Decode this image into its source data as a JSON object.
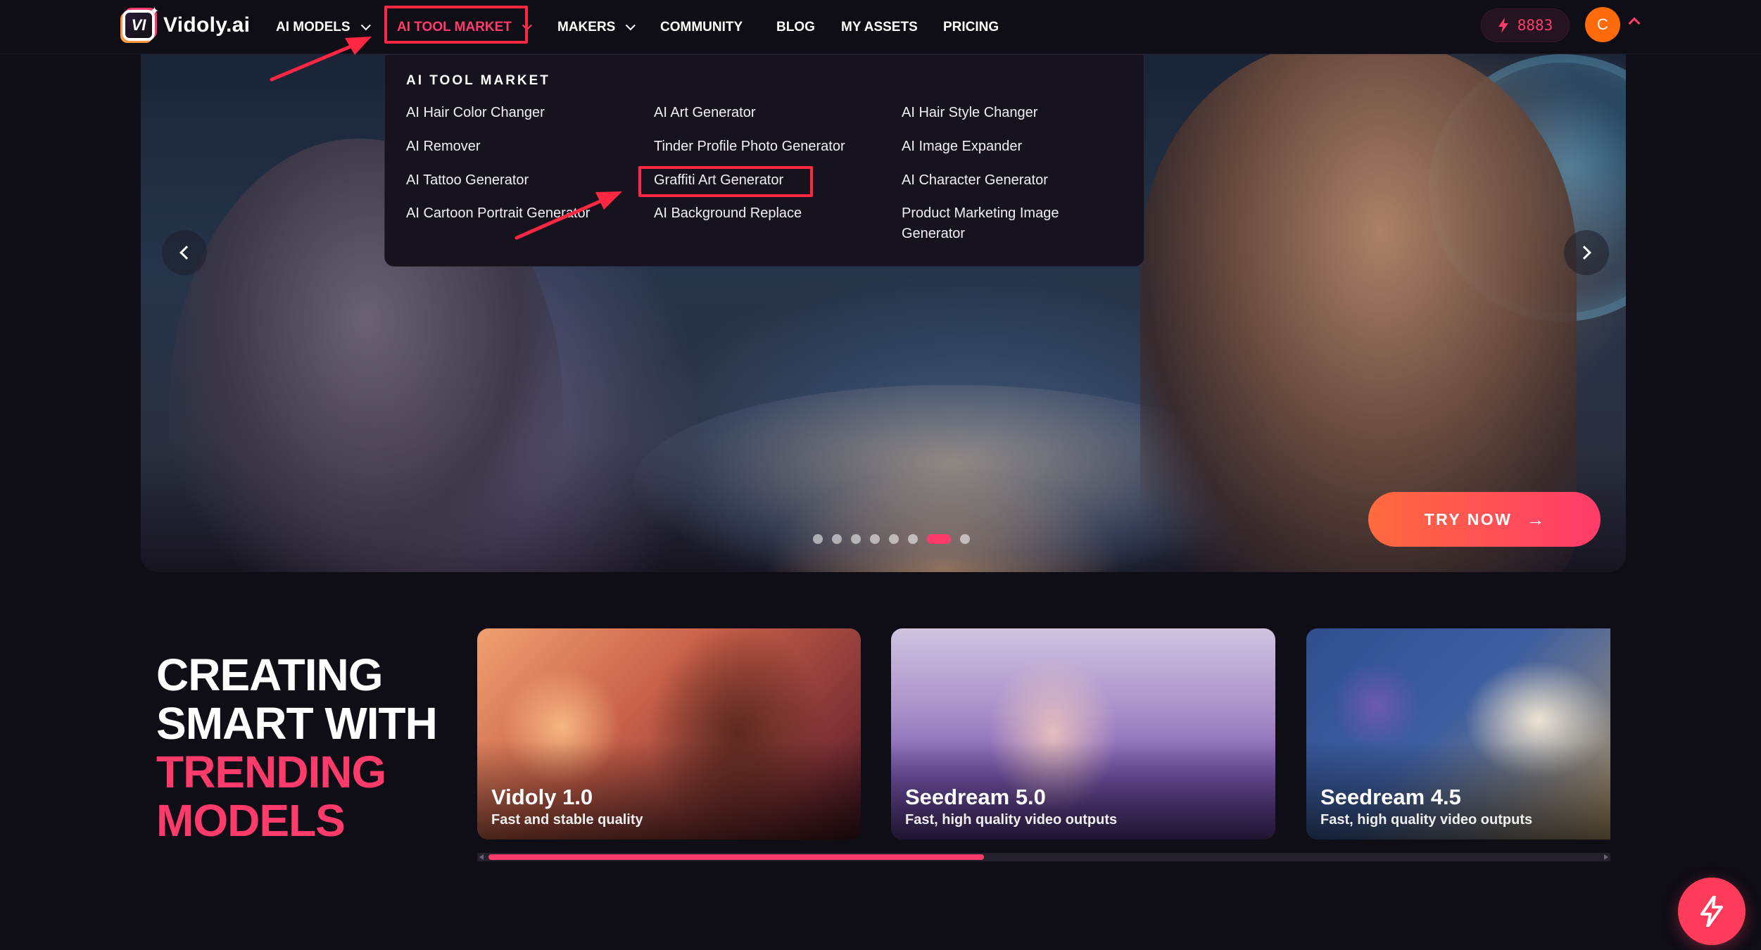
{
  "brand": {
    "name": "Vidoly.ai",
    "logo_mark": "VI"
  },
  "nav": {
    "items": [
      {
        "label": "AI MODELS",
        "has_dropdown": true,
        "active": false
      },
      {
        "label": "AI TOOL MARKET",
        "has_dropdown": true,
        "active": true
      },
      {
        "label": "MAKERS",
        "has_dropdown": true,
        "active": false
      },
      {
        "label": "COMMUNITY",
        "has_dropdown": false,
        "active": false
      },
      {
        "label": "BLOG",
        "has_dropdown": false,
        "active": false
      },
      {
        "label": "MY ASSETS",
        "has_dropdown": false,
        "active": false
      },
      {
        "label": "PRICING",
        "has_dropdown": false,
        "active": false
      }
    ],
    "credits": "8883",
    "credits_icon": "lightning-icon",
    "avatar_initial": "C",
    "avatar_caret_icon": "chevron-up-icon"
  },
  "dropdown": {
    "title": "AI TOOL MARKET",
    "columns": [
      [
        "AI Hair Color Changer",
        "AI Remover",
        "AI Tattoo Generator",
        "AI Cartoon Portrait Generator"
      ],
      [
        "AI Art Generator",
        "Tinder Profile Photo Generator",
        "Graffiti Art Generator",
        "AI Background Replace"
      ],
      [
        "AI Hair Style Changer",
        "AI Image Expander",
        "AI Character Generator",
        "Product Marketing Image Generator"
      ]
    ],
    "highlighted_item": "Graffiti Art Generator"
  },
  "hero": {
    "cta_label": "TRY NOW",
    "cta_icon": "arrow-right-icon",
    "prev_icon": "chevron-left-icon",
    "next_icon": "chevron-right-icon",
    "slide_count": 8,
    "active_slide": 6
  },
  "trending": {
    "heading_lines": [
      "CREATING",
      "SMART WITH",
      "TRENDING",
      "MODELS"
    ],
    "models": [
      {
        "name": "Vidoly 1.0",
        "description": "Fast and stable quality"
      },
      {
        "name": "Seedream 5.0",
        "description": "Fast, high quality video outputs"
      },
      {
        "name": "Seedream 4.5",
        "description": "Fast, high quality video outputs"
      }
    ]
  },
  "fab_icon": "lightning-icon",
  "colors": {
    "background": "#0f0d16",
    "accent": "#ff3b6b",
    "annotation": "#ff2741",
    "avatar": "#ff6a0a",
    "cta_gradient_start": "#ff6a3d",
    "cta_gradient_end": "#ff3b6b"
  }
}
